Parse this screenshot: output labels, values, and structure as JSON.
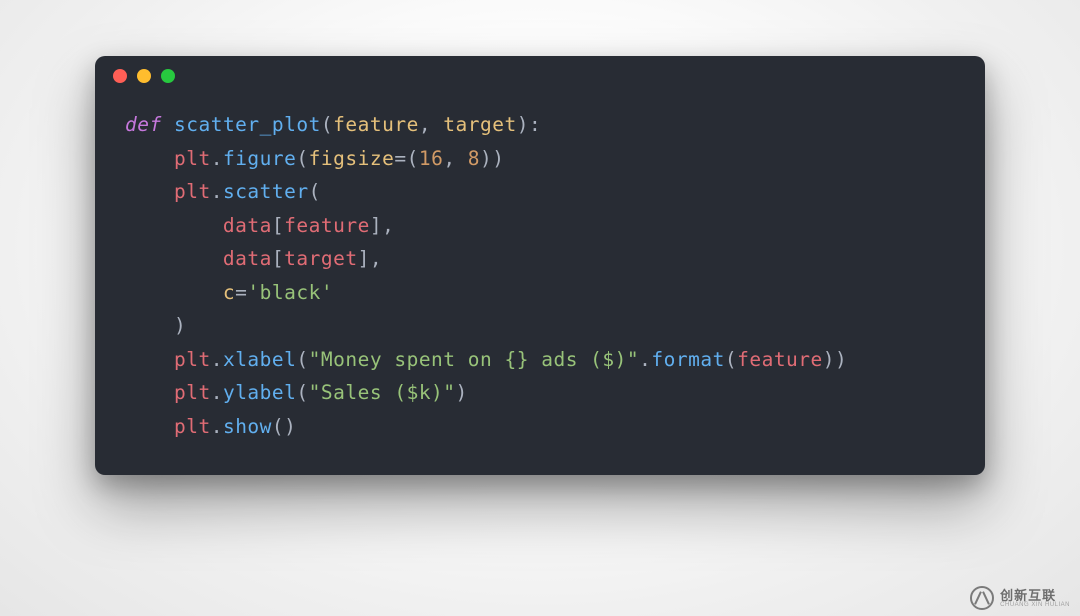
{
  "window": {
    "buttons": [
      "close",
      "minimize",
      "zoom"
    ]
  },
  "code": {
    "kw_def": "def",
    "fn_name": "scatter_plot",
    "param1": "feature",
    "param2": "target",
    "plt": "plt",
    "figure": "figure",
    "figsize_kw": "figsize",
    "figsize_w": "16",
    "figsize_h": "8",
    "scatter": "scatter",
    "data": "data",
    "idx_feature": "feature",
    "idx_target": "target",
    "c_kw": "c",
    "c_val": "'black'",
    "xlabel": "xlabel",
    "xlabel_str": "\"Money spent on {} ads ($)\"",
    "format": "format",
    "format_arg": "feature",
    "ylabel": "ylabel",
    "ylabel_str": "\"Sales ($k)\"",
    "show": "show"
  },
  "watermark": {
    "main": "创新互联",
    "sub": "CHUANG XIN HULIAN"
  }
}
